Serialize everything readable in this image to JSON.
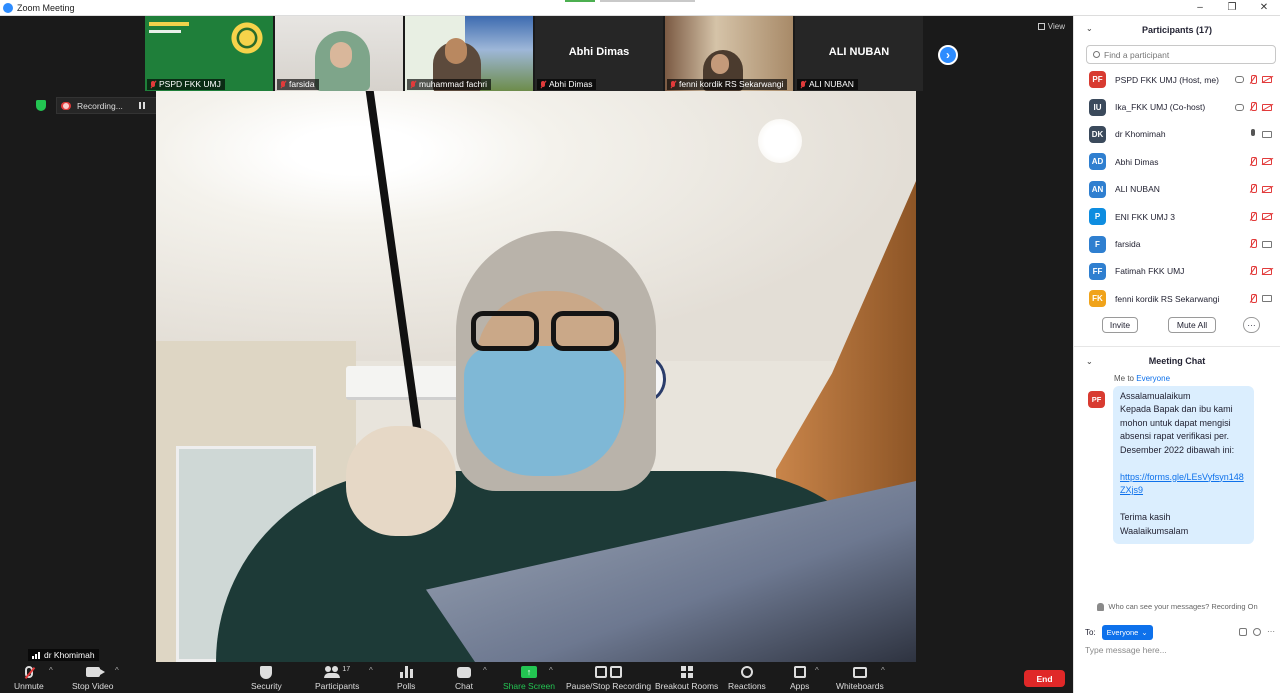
{
  "window": {
    "title": "Zoom Meeting",
    "controls": [
      "–",
      "❐",
      "✕"
    ]
  },
  "view_button": {
    "label": "View"
  },
  "gallery_strip": [
    {
      "name": "PSPD FKK UMJ",
      "style": "green",
      "muted": true
    },
    {
      "name": "farsida",
      "style": "photo1",
      "muted": true
    },
    {
      "name": "muhammad fachri",
      "style": "photo2",
      "muted": true
    },
    {
      "name": "Abhi Dimas",
      "style": "name",
      "center_name": "Abhi Dimas",
      "muted": true
    },
    {
      "name": "fenni kordik RS Sekarwangi",
      "style": "photo3",
      "muted": true
    },
    {
      "name": "ALI NUBAN",
      "style": "name",
      "center_name": "ALI NUBAN",
      "muted": true
    }
  ],
  "recording": {
    "label": "Recording..."
  },
  "active_speaker": {
    "name": "dr Khomimah"
  },
  "toolbar": {
    "unmute": "Unmute",
    "stop_video": "Stop Video",
    "security": "Security",
    "participants": "Participants",
    "participants_count": "17",
    "polls": "Polls",
    "chat": "Chat",
    "share_screen": "Share Screen",
    "pause_stop_recording": "Pause/Stop Recording",
    "breakout_rooms": "Breakout Rooms",
    "reactions": "Reactions",
    "apps": "Apps",
    "whiteboards": "Whiteboards",
    "end": "End"
  },
  "participants_panel": {
    "title": "Participants (17)",
    "search_placeholder": "Find a participant",
    "items": [
      {
        "initials": "PF",
        "name": "PSPD FKK UMJ (Host, me)",
        "color": "#d83b31",
        "mic": "off",
        "cam": "off",
        "recording": true
      },
      {
        "initials": "IU",
        "name": "Ika_FKK UMJ (Co-host)",
        "color": "#3b4a5c",
        "mic": "off",
        "cam": "off",
        "recording": true
      },
      {
        "initials": "DK",
        "name": "dr Khomimah",
        "color": "#3b4a5c",
        "mic": "on",
        "cam": "on",
        "recording": false
      },
      {
        "initials": "AD",
        "name": "Abhi Dimas",
        "color": "#2f7fd0",
        "mic": "off",
        "cam": "off",
        "recording": false
      },
      {
        "initials": "AN",
        "name": "ALI NUBAN",
        "color": "#2f7fd0",
        "mic": "off",
        "cam": "off",
        "recording": false
      },
      {
        "initials": "P",
        "name": "ENI FKK UMJ 3",
        "color": "#0e8de0",
        "mic": "off",
        "cam": "off",
        "recording": false
      },
      {
        "initials": "F",
        "name": "farsida",
        "color": "#2f7fd0",
        "mic": "off",
        "cam": "on",
        "recording": false
      },
      {
        "initials": "FF",
        "name": "Fatimah FKK UMJ",
        "color": "#2f7fd0",
        "mic": "off",
        "cam": "off",
        "recording": false
      },
      {
        "initials": "FK",
        "name": "fenni kordik RS Sekarwangi",
        "color": "#f0a31a",
        "mic": "off",
        "cam": "on",
        "recording": false
      }
    ],
    "invite": "Invite",
    "mute_all": "Mute All",
    "more": "···"
  },
  "chat_panel": {
    "title": "Meeting Chat",
    "meta_prefix": "Me to ",
    "meta_target": "Everyone",
    "sender_initials": "PF",
    "message_lines": "Assalamualaikum\nKepada Bapak dan ibu kami mohon untuk dapat mengisi absensi rapat verifikasi per. Desember 2022 dibawah ini:",
    "link": "https://forms.gle/LEsVyfsyn148ZXjs9",
    "closing": "Terima kasih\nWaalaikumsalam",
    "visibility_note": "Who can see your messages? Recording On",
    "to_label": "To:",
    "to_value": "Everyone",
    "input_placeholder": "Type message here..."
  }
}
